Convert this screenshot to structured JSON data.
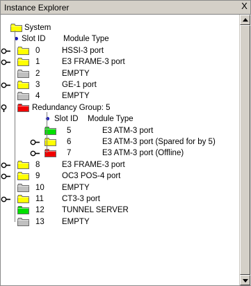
{
  "window": {
    "title": "Instance Explorer",
    "close_label": "X"
  },
  "tree": {
    "root": "System",
    "header": {
      "slot": "Slot ID",
      "type": "Module Type"
    },
    "slots": [
      {
        "slot": "0",
        "type": "HSSI-3 port",
        "color": "yellow",
        "expandable": true
      },
      {
        "slot": "1",
        "type": "E3 FRAME-3 port",
        "color": "yellow",
        "expandable": true
      },
      {
        "slot": "2",
        "type": "EMPTY",
        "color": "gray",
        "expandable": false
      },
      {
        "slot": "3",
        "type": "GE-1 port",
        "color": "yellow",
        "expandable": true
      },
      {
        "slot": "4",
        "type": "EMPTY",
        "color": "gray",
        "expandable": false
      }
    ],
    "redundancy": {
      "label": "Redundancy Group: 5",
      "color": "red",
      "header": {
        "slot": "Slot ID",
        "type": "Module Type"
      },
      "slots": [
        {
          "slot": "5",
          "type": "E3 ATM-3 port",
          "color": "green",
          "expandable": false
        },
        {
          "slot": "6",
          "type": "E3 ATM-3 port (Spared for by 5)",
          "color": "yellow",
          "expandable": true
        },
        {
          "slot": "7",
          "type": "E3 ATM-3 port (Offline)",
          "color": "red",
          "expandable": true
        }
      ]
    },
    "slots_after": [
      {
        "slot": "8",
        "type": "E3 FRAME-3 port",
        "color": "yellow",
        "expandable": true
      },
      {
        "slot": "9",
        "type": "OC3 POS-4 port",
        "color": "yellow",
        "expandable": true
      },
      {
        "slot": "10",
        "type": "EMPTY",
        "color": "gray",
        "expandable": false
      },
      {
        "slot": "11",
        "type": "CT3-3 port",
        "color": "yellow",
        "expandable": true
      },
      {
        "slot": "12",
        "type": "TUNNEL SERVER",
        "color": "green",
        "expandable": false
      },
      {
        "slot": "13",
        "type": "EMPTY",
        "color": "gray",
        "expandable": false
      }
    ]
  },
  "colors": {
    "yellow": "#ffff00",
    "gray": "#c0c0c0",
    "green": "#00e000",
    "red": "#f00000"
  }
}
